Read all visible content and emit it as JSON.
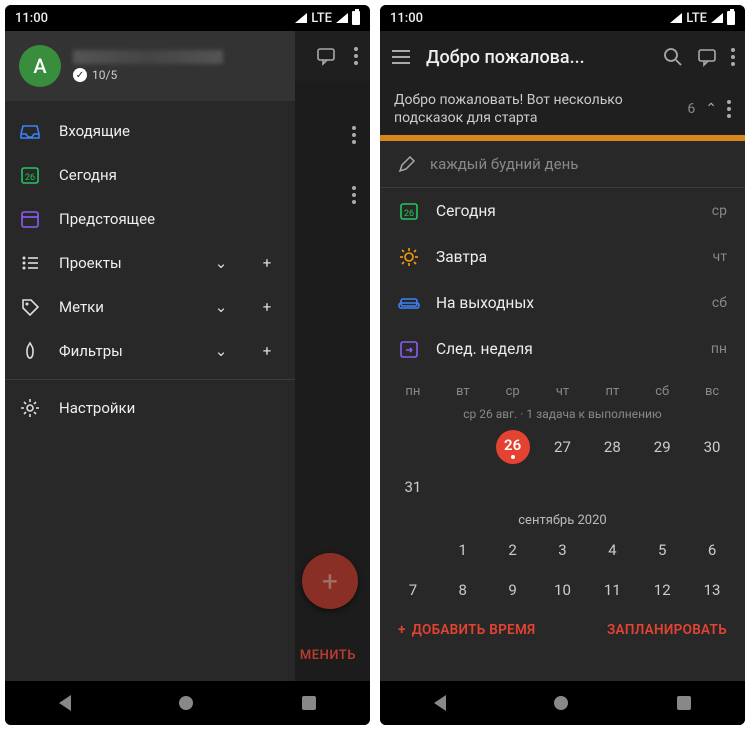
{
  "status": {
    "time": "11:00",
    "net": "LTE"
  },
  "left": {
    "avatar_letter": "A",
    "stats": "10/5",
    "nav": {
      "inbox": "Входящие",
      "today": "Сегодня",
      "upcoming": "Предстоящее",
      "projects": "Проекты",
      "labels": "Метки",
      "filters": "Фильтры",
      "settings": "Настройки"
    },
    "bg_action": "МЕНИТЬ"
  },
  "right": {
    "title": "Добро пожалова...",
    "sub_text": "Добро пожаловать! Вот несколько подсказок для старта",
    "sub_count": "6",
    "input_placeholder": "каждый будний день",
    "quick": [
      {
        "label": "Сегодня",
        "day": "ср"
      },
      {
        "label": "Завтра",
        "day": "чт"
      },
      {
        "label": "На выходных",
        "day": "сб"
      },
      {
        "label": "След. неделя",
        "day": "пн"
      }
    ],
    "weekdays": [
      "пн",
      "вт",
      "ср",
      "чт",
      "пт",
      "сб",
      "вс"
    ],
    "cal_subtitle": "ср 26 авг. · 1 задача к выполнению",
    "week1": [
      "",
      "",
      "26",
      "27",
      "28",
      "29",
      "30"
    ],
    "week1_muted": [
      true,
      true,
      false,
      false,
      false,
      false,
      false
    ],
    "week1_today_index": 2,
    "week2_leading": "31",
    "month2": "сентябрь 2020",
    "week3": [
      "",
      "1",
      "2",
      "3",
      "4",
      "5",
      "6"
    ],
    "week4": [
      "7",
      "8",
      "9",
      "10",
      "11",
      "12",
      "13"
    ],
    "add_time": "ДОБАВИТЬ ВРЕМЯ",
    "schedule": "ЗАПЛАНИРОВАТЬ"
  }
}
